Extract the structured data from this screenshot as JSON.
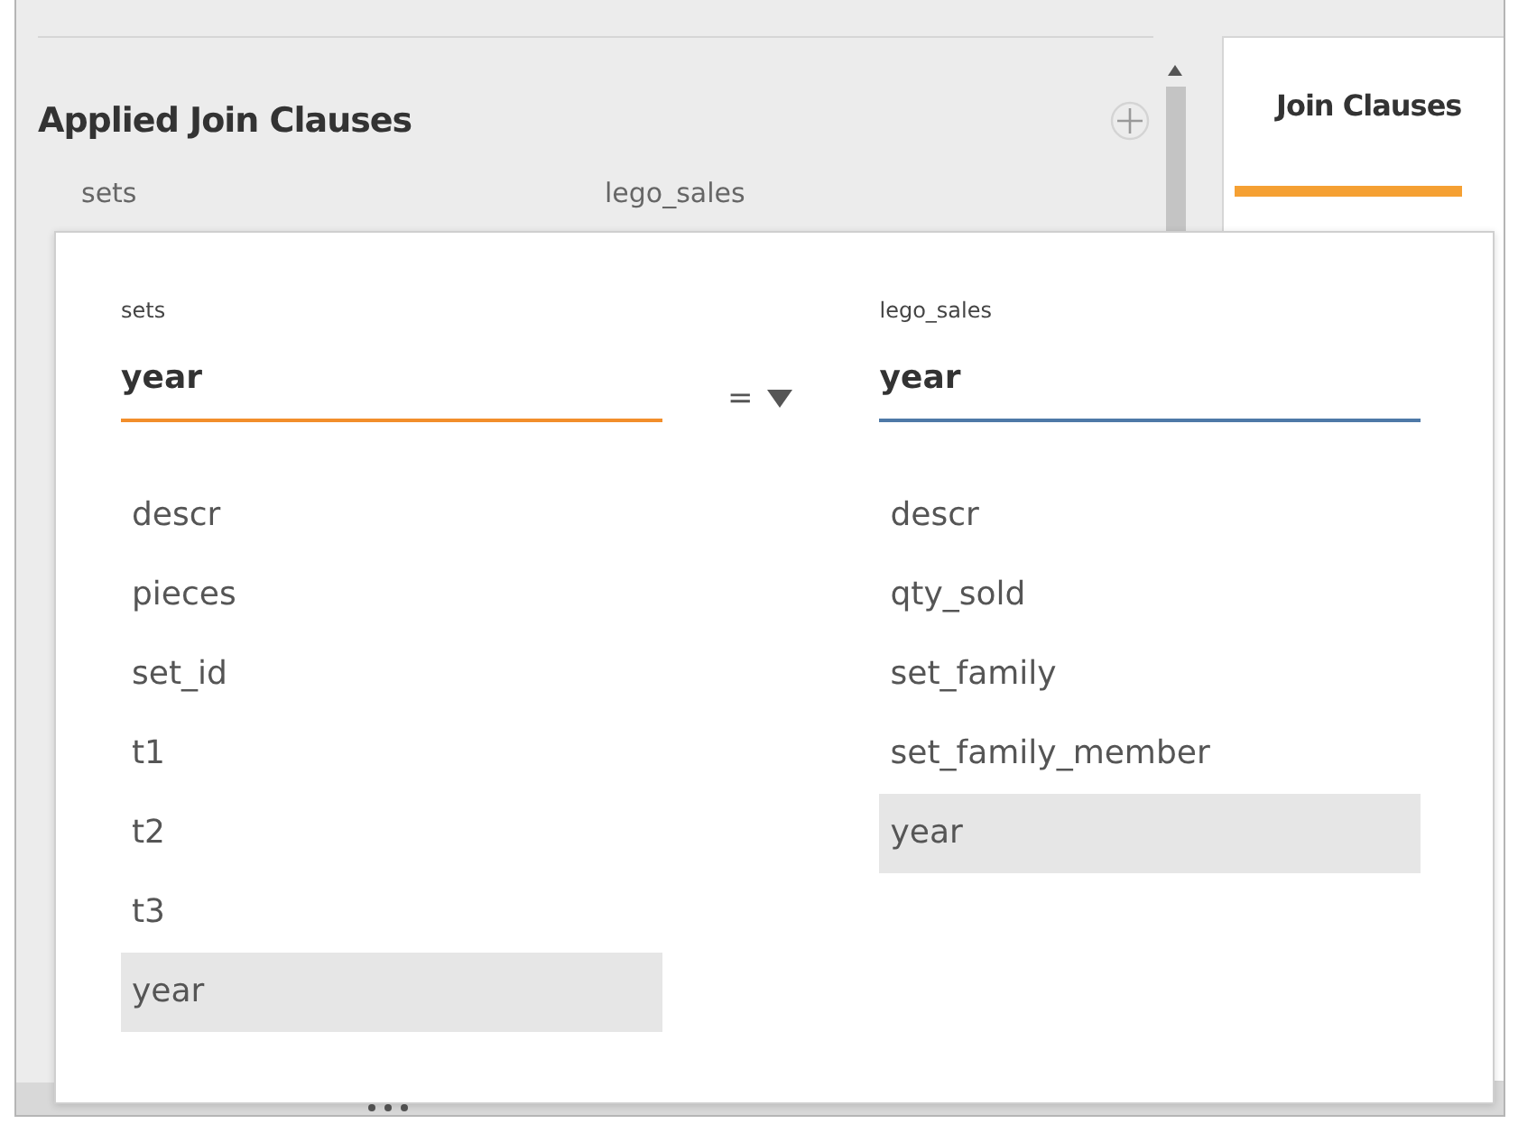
{
  "join_panel": {
    "heading": "Applied Join Clauses",
    "columns": [
      "sets",
      "lego_sales"
    ]
  },
  "tabs": [
    {
      "label": "Join Clauses",
      "selected": true
    }
  ],
  "join_editor": {
    "operator": "=",
    "sides": [
      {
        "table": "sets",
        "value": "year",
        "color": "#f28e2b",
        "fields": [
          {
            "name": "descr",
            "selected": false
          },
          {
            "name": "pieces",
            "selected": false
          },
          {
            "name": "set_id",
            "selected": false
          },
          {
            "name": "t1",
            "selected": false
          },
          {
            "name": "t2",
            "selected": false
          },
          {
            "name": "t3",
            "selected": false
          },
          {
            "name": "year",
            "selected": true
          }
        ]
      },
      {
        "table": "lego_sales",
        "value": "year",
        "color": "#4e79a7",
        "fields": [
          {
            "name": "descr",
            "selected": false
          },
          {
            "name": "qty_sold",
            "selected": false
          },
          {
            "name": "set_family",
            "selected": false
          },
          {
            "name": "set_family_member",
            "selected": false
          },
          {
            "name": "year",
            "selected": true
          }
        ]
      }
    ]
  }
}
